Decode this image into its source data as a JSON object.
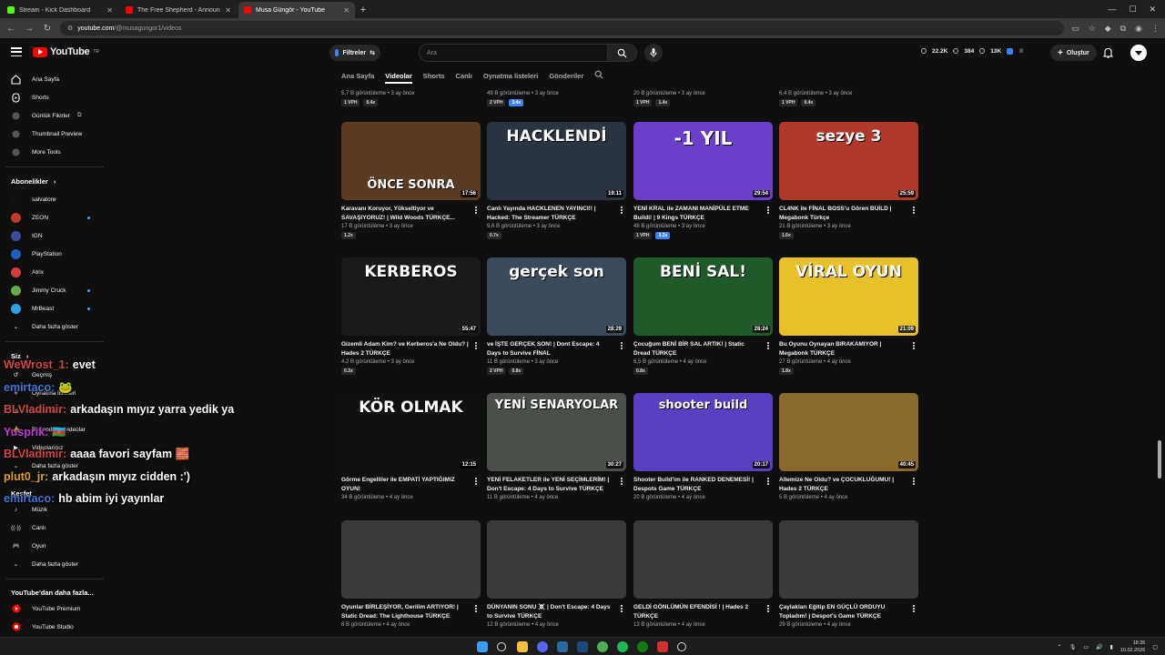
{
  "browser": {
    "tabs": [
      {
        "title": "Stream - Kick Dashboard",
        "color": "#53fc18",
        "active": false
      },
      {
        "title": "The Free Shepherd - Announce",
        "color": "#ff0000",
        "active": false
      },
      {
        "title": "Musa Güngör - YouTube",
        "color": "#ff0000",
        "active": true
      }
    ],
    "url_host": "youtube.com",
    "url_path": "/@musagungor1/videos"
  },
  "header": {
    "logo_text": "YouTube",
    "logo_region": "TR",
    "filters_label": "Filtreler",
    "search_placeholder": "Ara",
    "stats": [
      "22.2K",
      "384",
      "13K"
    ],
    "create_label": "Oluştur"
  },
  "sidebar": {
    "main": [
      {
        "label": "Ana Sayfa",
        "icon": "home-icon"
      },
      {
        "label": "Shorts",
        "icon": "shorts-icon"
      },
      {
        "label": "Günlük Fikirler",
        "icon": "ideas-icon"
      },
      {
        "label": "Thumbnail Preview",
        "icon": "thumbnail-icon"
      },
      {
        "label": "More Tools",
        "icon": "tools-icon"
      }
    ],
    "subs_title": "Abonelikler",
    "subs": [
      {
        "label": "salvatore",
        "color": "#111111",
        "dot": false
      },
      {
        "label": "ZEON",
        "color": "#c0392b",
        "dot": true
      },
      {
        "label": "IGN",
        "color": "#3b4a9c",
        "dot": false
      },
      {
        "label": "PlayStation",
        "color": "#1f5fbf",
        "dot": false
      },
      {
        "label": "Atrix",
        "color": "#d63a3a",
        "dot": false
      },
      {
        "label": "Jimmy Cruck",
        "color": "#6aa84f",
        "dot": true
      },
      {
        "label": "MrBeast",
        "color": "#29a3e6",
        "dot": true
      }
    ],
    "more_label": "Daha fazla göster",
    "you_title": "Siz",
    "you_items": [
      "Geçmiş",
      "Oynatma listeleri",
      "Sonra izle",
      "Beğendiğim videolar",
      "Videolarınız",
      "Daha fazla göster"
    ],
    "explore_title": "Keşfet",
    "explore_items": [
      "Müzik",
      "Canlı",
      "Oyun",
      "Daha fazla göster"
    ],
    "more_from_title": "YouTube'dan daha fazla...",
    "more_from": [
      "YouTube Premium",
      "YouTube Studio"
    ]
  },
  "chat": [
    {
      "name": "WeWrost_1:",
      "msg": "evet",
      "color": "#d64545"
    },
    {
      "name": "emirtaco:",
      "msg": "🐸",
      "color": "#3d78d8"
    },
    {
      "name": "BLVladimir:",
      "msg": "arkadaşın mıyız yarra yedik ya",
      "color": "#d64545"
    },
    {
      "name": "Yusprik:",
      "msg": "🇦🇿",
      "color": "#c23bd6"
    },
    {
      "name": "BLVladimir:",
      "msg": "aaaa favori sayfam 🧱",
      "color": "#d64545"
    },
    {
      "name": "plut0_jr:",
      "msg": "arkadaşın mıyız cidden :')",
      "color": "#e0a020"
    },
    {
      "name": "emirtaco:",
      "msg": "hb abim iyi yayınlar",
      "color": "#3d78d8"
    }
  ],
  "channel_tabs": [
    "Ana Sayfa",
    "Videolar",
    "Shorts",
    "Canlı",
    "Oynatma listeleri",
    "Gönderiler"
  ],
  "top_row": [
    {
      "meta": "5,7 B görüntüleme • 3 ay önce",
      "b1": "1 VPH",
      "b2": "0.4x"
    },
    {
      "meta": "49 B görüntüleme • 3 ay önce",
      "b1": "2 VPH",
      "b2": "3.4x"
    },
    {
      "meta": "20 B görüntüleme • 3 ay önce",
      "b1": "1 VPH",
      "b2": "1.4x"
    },
    {
      "meta": "6,4 B görüntüleme • 3 ay önce",
      "b1": "1 VPH",
      "b2": "0.4x"
    }
  ],
  "videos": [
    {
      "thumb_text": "ÖNCE  SONRA",
      "bg": "#5a3b22",
      "dur": "17:56",
      "title": "Karavanı Koruyor, Yükseltiyor ve SAVAŞIYORUZ! | Wild Woods TÜRKÇE...",
      "meta": "17 B görüntüleme • 3 ay önce",
      "b1": "",
      "b2": "1.2x"
    },
    {
      "thumb_text": "HACKLENDİ",
      "bg": "#2a3340",
      "dur": "19:11",
      "title": "Canlı Yayında HACKLENEN YAYINCI!! | Hacked: The Streamer TÜRKÇE",
      "meta": "9,6 B görüntüleme • 3 ay önce",
      "b1": "",
      "b2": "0.7x"
    },
    {
      "thumb_text": "-1 YIL",
      "bg": "#6b3fc9",
      "dur": "29:54",
      "title": "YENİ KRAL ile ZAMANI MANİPÜLE ETME Buildi! | 9 Kings TÜRKÇE",
      "meta": "48 B görüntüleme • 3 ay önce",
      "b1": "1 VPH",
      "b2": "3.3x"
    },
    {
      "thumb_text": "sezye 3",
      "bg": "#b03a2a",
      "dur": "25:59",
      "title": "CL4NK ile FİNAL BOSS'u Gören BUILD | Megabonk Türkçe",
      "meta": "21 B görüntüleme • 3 ay önce",
      "b1": "",
      "b2": "1.6x"
    },
    {
      "thumb_text": "KERBEROS",
      "bg": "#1a1a1a",
      "dur": "55:47",
      "title": "Gizemli Adam Kim? ve Kerberos'a Ne Oldu? | Hades 2 TÜRKÇE",
      "meta": "4,2 B görüntüleme • 3 ay önce",
      "b1": "",
      "b2": "0.3x"
    },
    {
      "thumb_text": "gerçek son",
      "bg": "#3a4a5a",
      "dur": "28:29",
      "title": "ve İŞTE GERÇEK SON! | Dont Escape: 4 Days to Survive FİNAL",
      "meta": "11 B görüntüleme • 3 ay önce",
      "b1": "2 VPH",
      "b2": "0.8x"
    },
    {
      "thumb_text": "BENİ SAL!",
      "bg": "#1f5a2a",
      "dur": "28:24",
      "title": "Çocuğum BENİ BİR SAL ARTIK! | Static Dread TÜRKÇE",
      "meta": "6,5 B görüntüleme • 4 ay önce",
      "b1": "",
      "b2": "0.8x"
    },
    {
      "thumb_text": "VİRAL OYUN",
      "bg": "#e8c12a",
      "dur": "21:09",
      "title": "Bu Oyunu Oynayan BIRAKAMIYOR | Megabonk TÜRKÇE",
      "meta": "27 B görüntüleme • 4 ay önce",
      "b1": "",
      "b2": "1.8x"
    },
    {
      "thumb_text": "KÖR OLMAK",
      "bg": "#111111",
      "dur": "12:15",
      "title": "Görme Engelliler ile EMPATİ YAPTIĞIMIZ OYUN!",
      "meta": "34 B görüntüleme • 4 ay önce",
      "b1": "",
      "b2": ""
    },
    {
      "thumb_text": "YENİ SENARYOLAR",
      "bg": "#4a4f4a",
      "dur": "30:27",
      "title": "YENİ FELAKETLER ile YENİ SEÇİMLERİM! | Don't Escape: 4 Days to Survive TÜRKÇE",
      "meta": "11 B görüntüleme • 4 ay önce",
      "b1": "",
      "b2": ""
    },
    {
      "thumb_text": "shooter build",
      "bg": "#5a3fc0",
      "dur": "20:17",
      "title": "Shooter Build'im ile RANKED DENEMESİ! | Despots Game TÜRKÇE",
      "meta": "20 B görüntüleme • 4 ay önce",
      "b1": "",
      "b2": ""
    },
    {
      "thumb_text": "",
      "bg": "#8a6a2a",
      "dur": "40:45",
      "title": "Allemize Ne Oldu? ve ÇOCUKLUĞUMU! | Hades 2 TÜRKÇE",
      "meta": "5 B görüntüleme • 4 ay önce",
      "b1": "",
      "b2": ""
    },
    {
      "thumb_text": "",
      "bg": "#3a3a3a",
      "dur": "",
      "title": "Oyunlar BİRLEŞİYOR, Gerilim ARTIYOR! | Static Dread: The Lighthouse TÜRKÇE",
      "meta": "8 B görüntüleme • 4 ay önce",
      "b1": "",
      "b2": ""
    },
    {
      "thumb_text": "",
      "bg": "#3a3a3a",
      "dur": "",
      "title": "DÜNYANIN SONU ☠️ | Don't Escape: 4 Days to Survive TÜRKÇE",
      "meta": "12 B görüntüleme • 4 ay önce",
      "b1": "",
      "b2": ""
    },
    {
      "thumb_text": "",
      "bg": "#3a3a3a",
      "dur": "",
      "title": "GELDİ GÖNLÜMÜN EFENDİSİ ! | Hades 2 TÜRKÇE",
      "meta": "13 B görüntüleme • 4 ay önce",
      "b1": "",
      "b2": ""
    },
    {
      "thumb_text": "",
      "bg": "#3a3a3a",
      "dur": "",
      "title": "Çaylakları Eğitip EN GÜÇLÜ ORDUYU Topladım! | Despot's Game TÜRKÇE",
      "meta": "29 B görüntüleme • 4 ay önce",
      "b1": "",
      "b2": ""
    }
  ],
  "taskbar": {
    "time": "18:35",
    "date": "10.02.2026"
  }
}
